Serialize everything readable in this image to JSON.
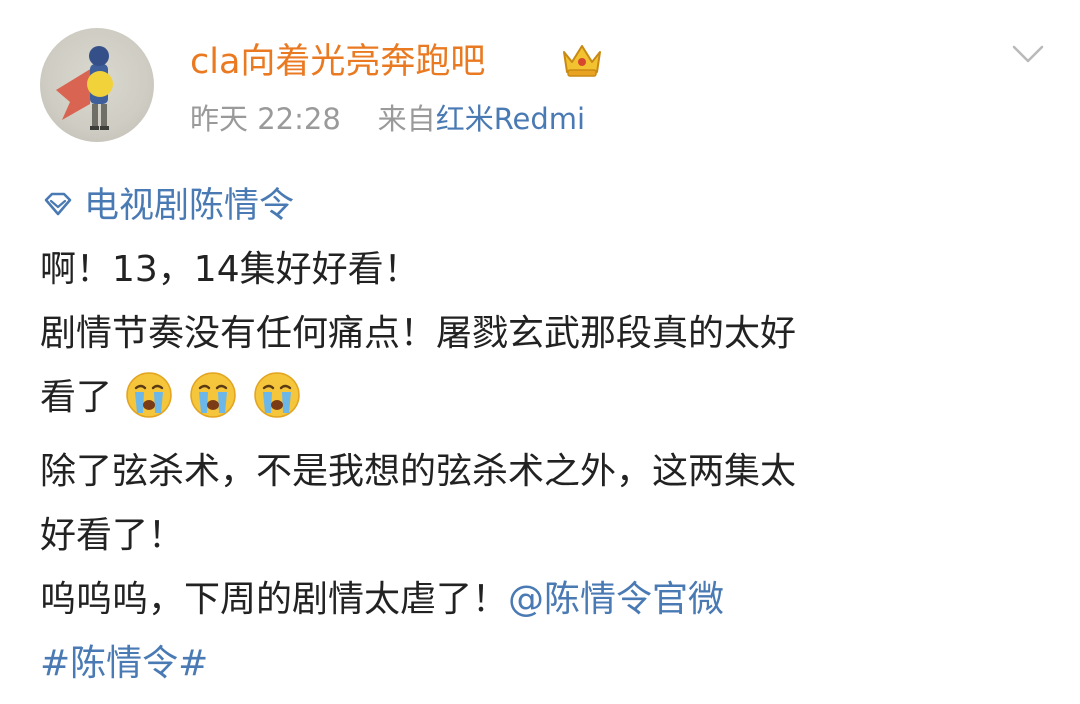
{
  "post": {
    "username": "cla向着光亮奔跑吧",
    "time": "昨天 22:28",
    "source_prefix": "来自",
    "source_device": "红米Redmi",
    "topic": "电视剧陈情令",
    "lines": {
      "l1": "啊！13，14集好好看！",
      "l2": "剧情节奏没有任何痛点！屠戮玄武那段真的太好",
      "l3": "看了",
      "l4": "除了弦杀术，不是我想的弦杀术之外，这两集太",
      "l5": "好看了！",
      "l6_text": "呜呜呜，下周的剧情太虐了！",
      "l6_mention": "@陈情令官微",
      "l7_hashtag": "#陈情令#"
    }
  },
  "icons": {
    "avatar": "avatar-image",
    "crown": "crown-vip-icon",
    "chevron": "chevron-down-icon",
    "topic": "topic-diamond-icon",
    "emoji": "crying-face-emoji"
  },
  "colors": {
    "username": "#ea7a22",
    "link": "#4a7ab3",
    "meta": "#9a9a9a",
    "text": "#222222"
  }
}
